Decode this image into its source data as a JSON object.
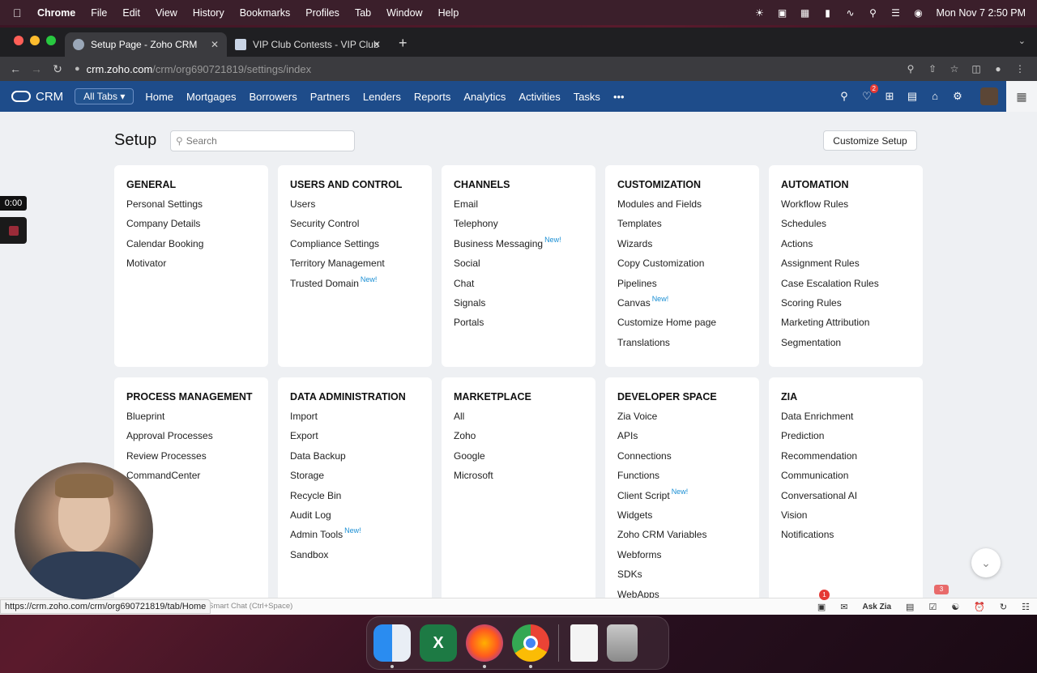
{
  "menubar": {
    "app": "Chrome",
    "items": [
      "File",
      "Edit",
      "View",
      "History",
      "Bookmarks",
      "Profiles",
      "Tab",
      "Window",
      "Help"
    ],
    "clock": "Mon Nov 7  2:50 PM"
  },
  "browser": {
    "tabs": [
      {
        "title": "Setup Page - Zoho CRM",
        "active": true
      },
      {
        "title": "VIP Club Contests - VIP Club",
        "active": false
      }
    ],
    "url_host": "crm.zoho.com",
    "url_path": "/crm/org690721819/settings/index"
  },
  "crm": {
    "brand": "CRM",
    "all_tabs": "All Tabs",
    "nav": [
      "Home",
      "Mortgages",
      "Borrowers",
      "Partners",
      "Lenders",
      "Reports",
      "Analytics",
      "Activities",
      "Tasks"
    ],
    "more": "•••",
    "notif_count": "2"
  },
  "setup": {
    "title": "Setup",
    "search_placeholder": "Search",
    "customize_button": "Customize Setup",
    "new_label": "New!",
    "cards_row1": [
      {
        "title": "GENERAL",
        "items": [
          {
            "t": "Personal Settings"
          },
          {
            "t": "Company Details"
          },
          {
            "t": "Calendar Booking"
          },
          {
            "t": "Motivator"
          }
        ]
      },
      {
        "title": "USERS AND CONTROL",
        "items": [
          {
            "t": "Users"
          },
          {
            "t": "Security Control"
          },
          {
            "t": "Compliance Settings"
          },
          {
            "t": "Territory Management"
          },
          {
            "t": "Trusted Domain",
            "new": true
          }
        ]
      },
      {
        "title": "CHANNELS",
        "items": [
          {
            "t": "Email"
          },
          {
            "t": "Telephony"
          },
          {
            "t": "Business Messaging",
            "new": true
          },
          {
            "t": "Social"
          },
          {
            "t": "Chat"
          },
          {
            "t": "Signals"
          },
          {
            "t": "Portals"
          }
        ]
      },
      {
        "title": "CUSTOMIZATION",
        "items": [
          {
            "t": "Modules and Fields"
          },
          {
            "t": "Templates"
          },
          {
            "t": "Wizards"
          },
          {
            "t": "Copy Customization"
          },
          {
            "t": "Pipelines"
          },
          {
            "t": "Canvas",
            "new": true
          },
          {
            "t": "Customize Home page"
          },
          {
            "t": "Translations"
          }
        ]
      },
      {
        "title": "AUTOMATION",
        "items": [
          {
            "t": "Workflow Rules"
          },
          {
            "t": "Schedules"
          },
          {
            "t": "Actions"
          },
          {
            "t": "Assignment Rules"
          },
          {
            "t": "Case Escalation Rules"
          },
          {
            "t": "Scoring Rules"
          },
          {
            "t": "Marketing Attribution"
          },
          {
            "t": "Segmentation"
          }
        ]
      }
    ],
    "cards_row2": [
      {
        "title": "PROCESS MANAGEMENT",
        "items": [
          {
            "t": "Blueprint"
          },
          {
            "t": "Approval Processes"
          },
          {
            "t": "Review Processes"
          },
          {
            "t": "CommandCenter"
          }
        ]
      },
      {
        "title": "DATA ADMINISTRATION",
        "items": [
          {
            "t": "Import"
          },
          {
            "t": "Export"
          },
          {
            "t": "Data Backup"
          },
          {
            "t": "Storage"
          },
          {
            "t": "Recycle Bin"
          },
          {
            "t": "Audit Log"
          },
          {
            "t": "Admin Tools",
            "new": true
          },
          {
            "t": "Sandbox"
          }
        ]
      },
      {
        "title": "MARKETPLACE",
        "items": [
          {
            "t": "All"
          },
          {
            "t": "Zoho"
          },
          {
            "t": "Google"
          },
          {
            "t": "Microsoft"
          }
        ]
      },
      {
        "title": "DEVELOPER SPACE",
        "items": [
          {
            "t": "Zia Voice"
          },
          {
            "t": "APIs"
          },
          {
            "t": "Connections"
          },
          {
            "t": "Functions"
          },
          {
            "t": "Client Script",
            "new": true
          },
          {
            "t": "Widgets"
          },
          {
            "t": "Zoho CRM Variables"
          },
          {
            "t": "Webforms"
          },
          {
            "t": "SDKs"
          },
          {
            "t": "WebApps"
          }
        ]
      },
      {
        "title": "ZIA",
        "items": [
          {
            "t": "Data Enrichment"
          },
          {
            "t": "Prediction"
          },
          {
            "t": "Recommendation"
          },
          {
            "t": "Communication"
          },
          {
            "t": "Conversational AI"
          },
          {
            "t": "Vision"
          },
          {
            "t": "Notifications"
          }
        ]
      }
    ]
  },
  "overlay": {
    "timer": "0:00",
    "status_url": "https://crm.zoho.com/crm/org690721819/tab/Home",
    "smart_chat": "Smart Chat (Ctrl+Space)",
    "ask_zia": "Ask Zia",
    "badge1": "1",
    "badge2": "3"
  }
}
